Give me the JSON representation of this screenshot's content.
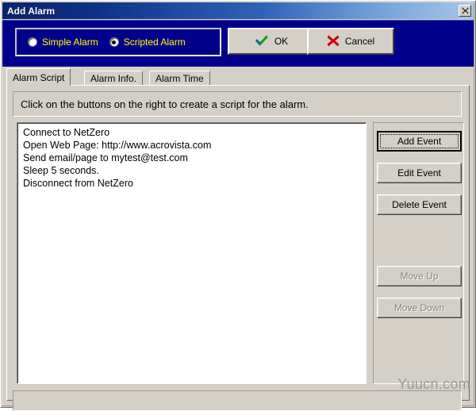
{
  "window": {
    "title": "Add Alarm",
    "close_label": "✕"
  },
  "toolbar": {
    "modes": [
      {
        "label": "Simple Alarm",
        "selected": false
      },
      {
        "label": "Scripted Alarm",
        "selected": true
      }
    ],
    "ok_label": "OK",
    "ok_icon": "check-icon",
    "ok_glyph": "✔",
    "cancel_label": "Cancel",
    "cancel_icon": "cross-icon",
    "cancel_glyph": "✖"
  },
  "tabs": [
    {
      "label": "Alarm Script",
      "active": true
    },
    {
      "label": "Alarm Info.",
      "active": false
    },
    {
      "label": "Alarm Time",
      "active": false
    }
  ],
  "page": {
    "instruction": "Click on the buttons on the right to create a script for the alarm.",
    "script_lines": [
      "Connect to NetZero",
      "Open Web Page: http://www.acrovista.com",
      "Send email/page to mytest@test.com",
      "Sleep 5 seconds.",
      "Disconnect from NetZero"
    ],
    "buttons": [
      {
        "label": "Add Event",
        "state": "focused"
      },
      {
        "label": "Edit Event",
        "state": "enabled"
      },
      {
        "label": "Delete Event",
        "state": "enabled"
      },
      {
        "label": "Move Up",
        "state": "disabled"
      },
      {
        "label": "Move Down",
        "state": "disabled"
      }
    ]
  },
  "watermark": "Yuucn.com",
  "colors": {
    "titlebar_start": "#0a246a",
    "titlebar_end": "#a7c6e8",
    "toolbar_bg": "#00008b",
    "radio_label": "#ffff00",
    "face": "#d4d0c8",
    "ok_check": "#1aa01a",
    "cancel_cross": "#cc0000",
    "watermark": "#9a9a9a"
  }
}
